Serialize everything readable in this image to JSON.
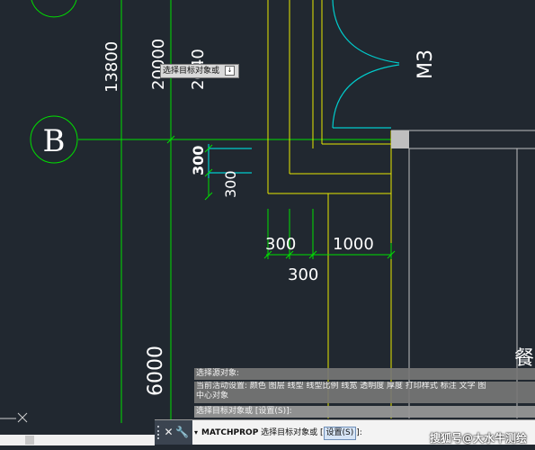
{
  "drawing": {
    "axis_b_label": "B",
    "door_label": "M3",
    "room_label_partial": "餐",
    "dims": {
      "d_13800": "13800",
      "d_20000": "20000",
      "d_2040": "2040",
      "d_300_selected": "300",
      "d_300_vertical": "300",
      "d_300_a": "300",
      "d_1000": "1000",
      "d_300_b": "300",
      "d_6000": "6000"
    }
  },
  "tooltip": {
    "text": "选择目标对象或",
    "button_glyph": "↓"
  },
  "history": {
    "line1": "选择源对象:",
    "line2": "当前活动设置:   颜色 图层 线型 线型比例 线宽 透明度 厚度 打印样式 标注 文字 图",
    "line2b": "中心对象",
    "line3": "选择目标对象或 [设置(S)]:"
  },
  "command": {
    "close_glyph": "✕",
    "tool_glyph": "🔧",
    "dropdown_glyph": "▾",
    "name": "MATCHPROP",
    "prompt": "选择目标对象或 [",
    "option": "设置(S)",
    "suffix": "]:"
  },
  "watermark": "搜狐号@大水牛测绘",
  "colors": {
    "background": "#212830",
    "green": "#00e000",
    "yellow": "#e8e800",
    "cyan": "#00cccc",
    "gray": "#bfbfbf"
  }
}
